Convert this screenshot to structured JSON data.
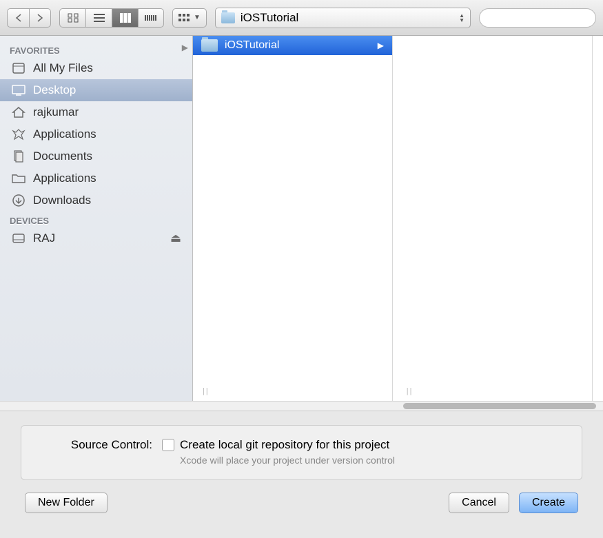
{
  "toolbar": {
    "path_label": "iOSTutorial",
    "search_placeholder": ""
  },
  "sidebar": {
    "sections": [
      {
        "header": "FAVORITES",
        "items": [
          {
            "label": "All My Files",
            "icon": "all-files",
            "selected": false
          },
          {
            "label": "Desktop",
            "icon": "desktop",
            "selected": true
          },
          {
            "label": "rajkumar",
            "icon": "home",
            "selected": false
          },
          {
            "label": "Applications",
            "icon": "apps",
            "selected": false
          },
          {
            "label": "Documents",
            "icon": "documents",
            "selected": false
          },
          {
            "label": "Applications",
            "icon": "folder",
            "selected": false
          },
          {
            "label": "Downloads",
            "icon": "downloads",
            "selected": false
          }
        ]
      },
      {
        "header": "DEVICES",
        "items": [
          {
            "label": "RAJ",
            "icon": "disk",
            "selected": false,
            "ejectable": true
          }
        ]
      }
    ]
  },
  "columns": [
    {
      "items": [
        {
          "label": "iOSTutorial",
          "selected": true,
          "has_children": true
        }
      ]
    }
  ],
  "options": {
    "label": "Source Control:",
    "checkbox_label": "Create local git repository for this project",
    "checkbox_checked": false,
    "sub_text": "Xcode will place your project under version control"
  },
  "footer": {
    "new_folder": "New Folder",
    "cancel": "Cancel",
    "create": "Create"
  }
}
